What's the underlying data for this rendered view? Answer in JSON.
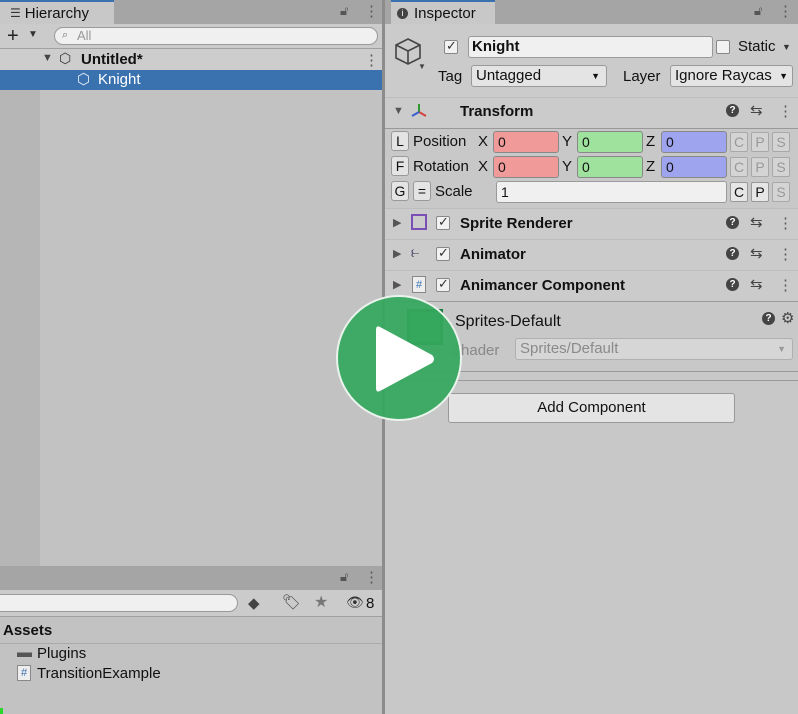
{
  "hierarchy": {
    "tab_label": "Hierarchy",
    "search_placeholder": "All",
    "scene_name": "Untitled*",
    "selected_object": "Knight"
  },
  "project": {
    "folder_header": "Assets",
    "hidden_count": "8",
    "items": [
      {
        "name": "Plugins",
        "icon": "folder-icon"
      },
      {
        "name": "TransitionExample",
        "icon": "script-icon"
      }
    ]
  },
  "inspector": {
    "tab_label": "Inspector",
    "object_name": "Knight",
    "static_label": "Static",
    "tag_label": "Tag",
    "tag_value": "Untagged",
    "layer_label": "Layer",
    "layer_value": "Ignore Raycas",
    "transform": {
      "title": "Transform",
      "position_btn": "L",
      "rotation_btn": "F",
      "scale_btn": "G",
      "link_btn": "=",
      "position_label": "Position",
      "rotation_label": "Rotation",
      "scale_label": "Scale",
      "x_label": "X",
      "y_label": "Y",
      "z_label": "Z",
      "position": {
        "x": "0",
        "y": "0",
        "z": "0"
      },
      "rotation": {
        "x": "0",
        "y": "0",
        "z": "0"
      },
      "scale": "1",
      "c_label": "C",
      "p_label": "P",
      "s_label": "S"
    },
    "components": [
      {
        "title": "Sprite Renderer"
      },
      {
        "title": "Animator"
      },
      {
        "title": "Animancer Component"
      }
    ],
    "material": {
      "name": "Sprites-Default",
      "shader_label": "Shader",
      "shader_value": "Sprites/Default"
    },
    "add_component_label": "Add Component"
  },
  "colors": {
    "selection": "#3a72b0",
    "x_field": "#f19a9a",
    "y_field": "#9ee29e",
    "z_field": "#9fa4ef",
    "play_overlay": "#35a85e"
  }
}
